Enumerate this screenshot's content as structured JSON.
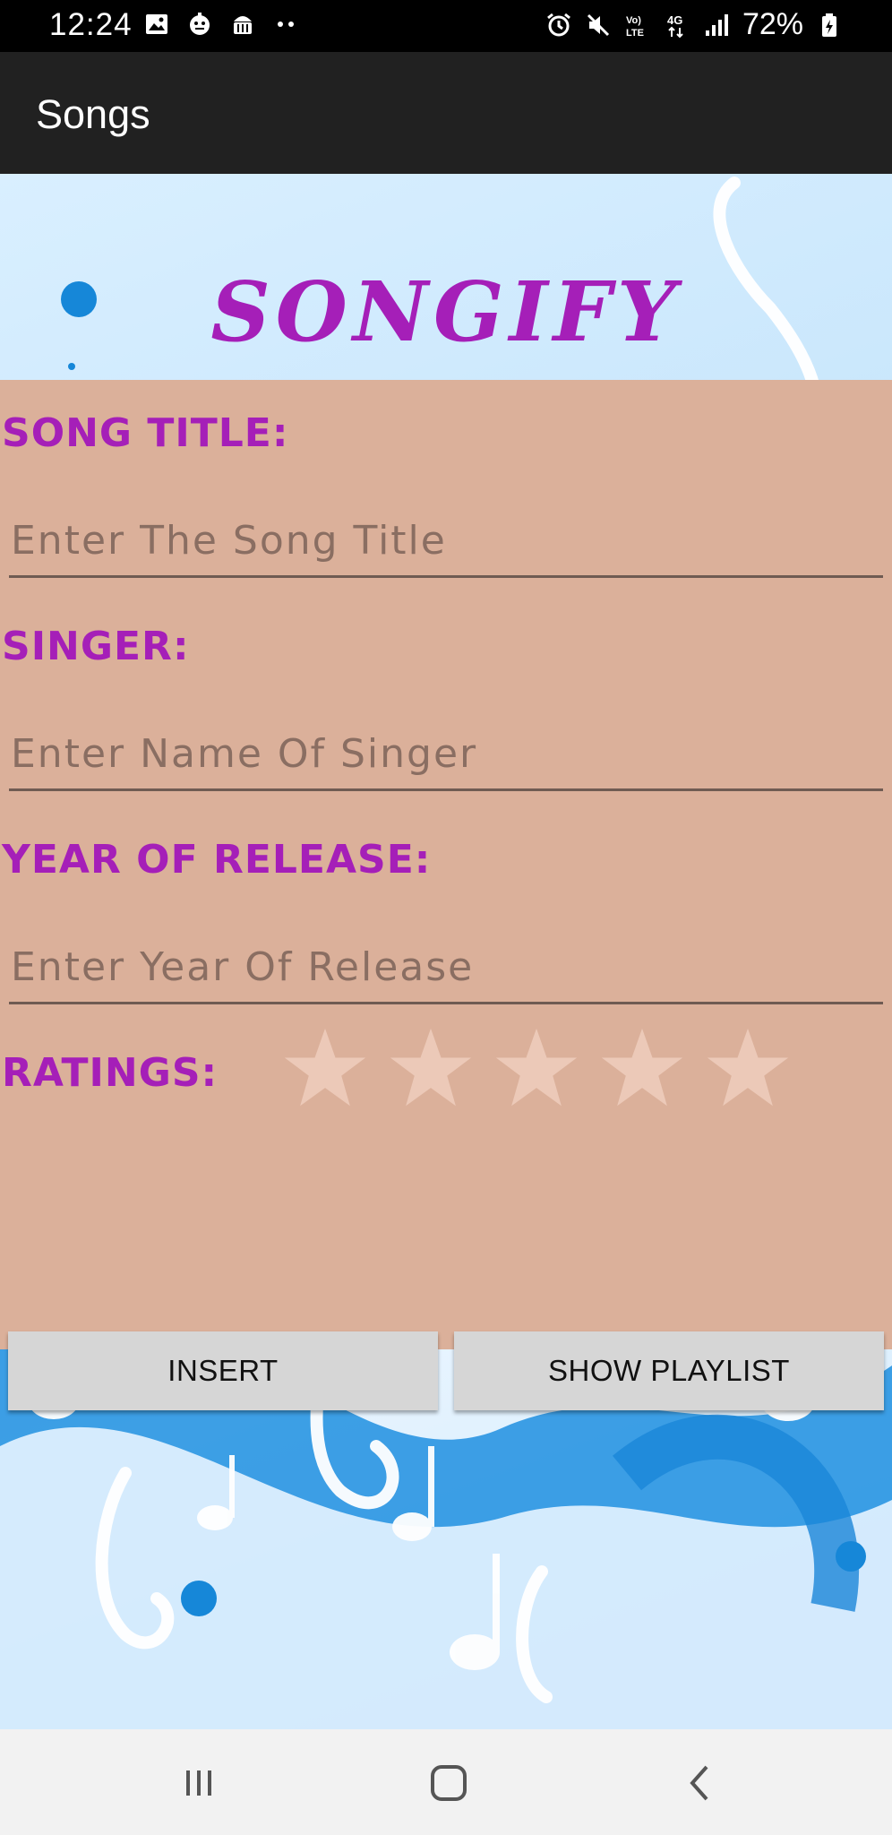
{
  "status_bar": {
    "time": "12:24",
    "battery": "72%",
    "left_icons": [
      "image-icon",
      "robot-icon",
      "android-icon",
      "dots-icon"
    ],
    "right_icons": [
      "alarm-icon",
      "mute-icon",
      "volte-icon",
      "4g-icon",
      "signal-icon",
      "battery-icon"
    ]
  },
  "app_bar": {
    "title": "Songs"
  },
  "brand": {
    "title": "SONGIFY"
  },
  "form": {
    "song_title_label": "SONG TITLE:",
    "song_title_placeholder": "Enter The Song Title",
    "singer_label": "SINGER:",
    "singer_placeholder": "Enter Name Of Singer",
    "year_label": "YEAR OF RELEASE:",
    "year_placeholder": "Enter Year Of Release",
    "ratings_label": "RATINGS:",
    "rating": {
      "value": 0,
      "max": 5
    }
  },
  "buttons": {
    "insert": "INSERT",
    "show_playlist": "SHOW PLAYLIST"
  },
  "colors": {
    "accent": "#a51fb8",
    "panel": "#dbb09a",
    "app_bar": "#212121",
    "button": "#d6d6d6"
  }
}
